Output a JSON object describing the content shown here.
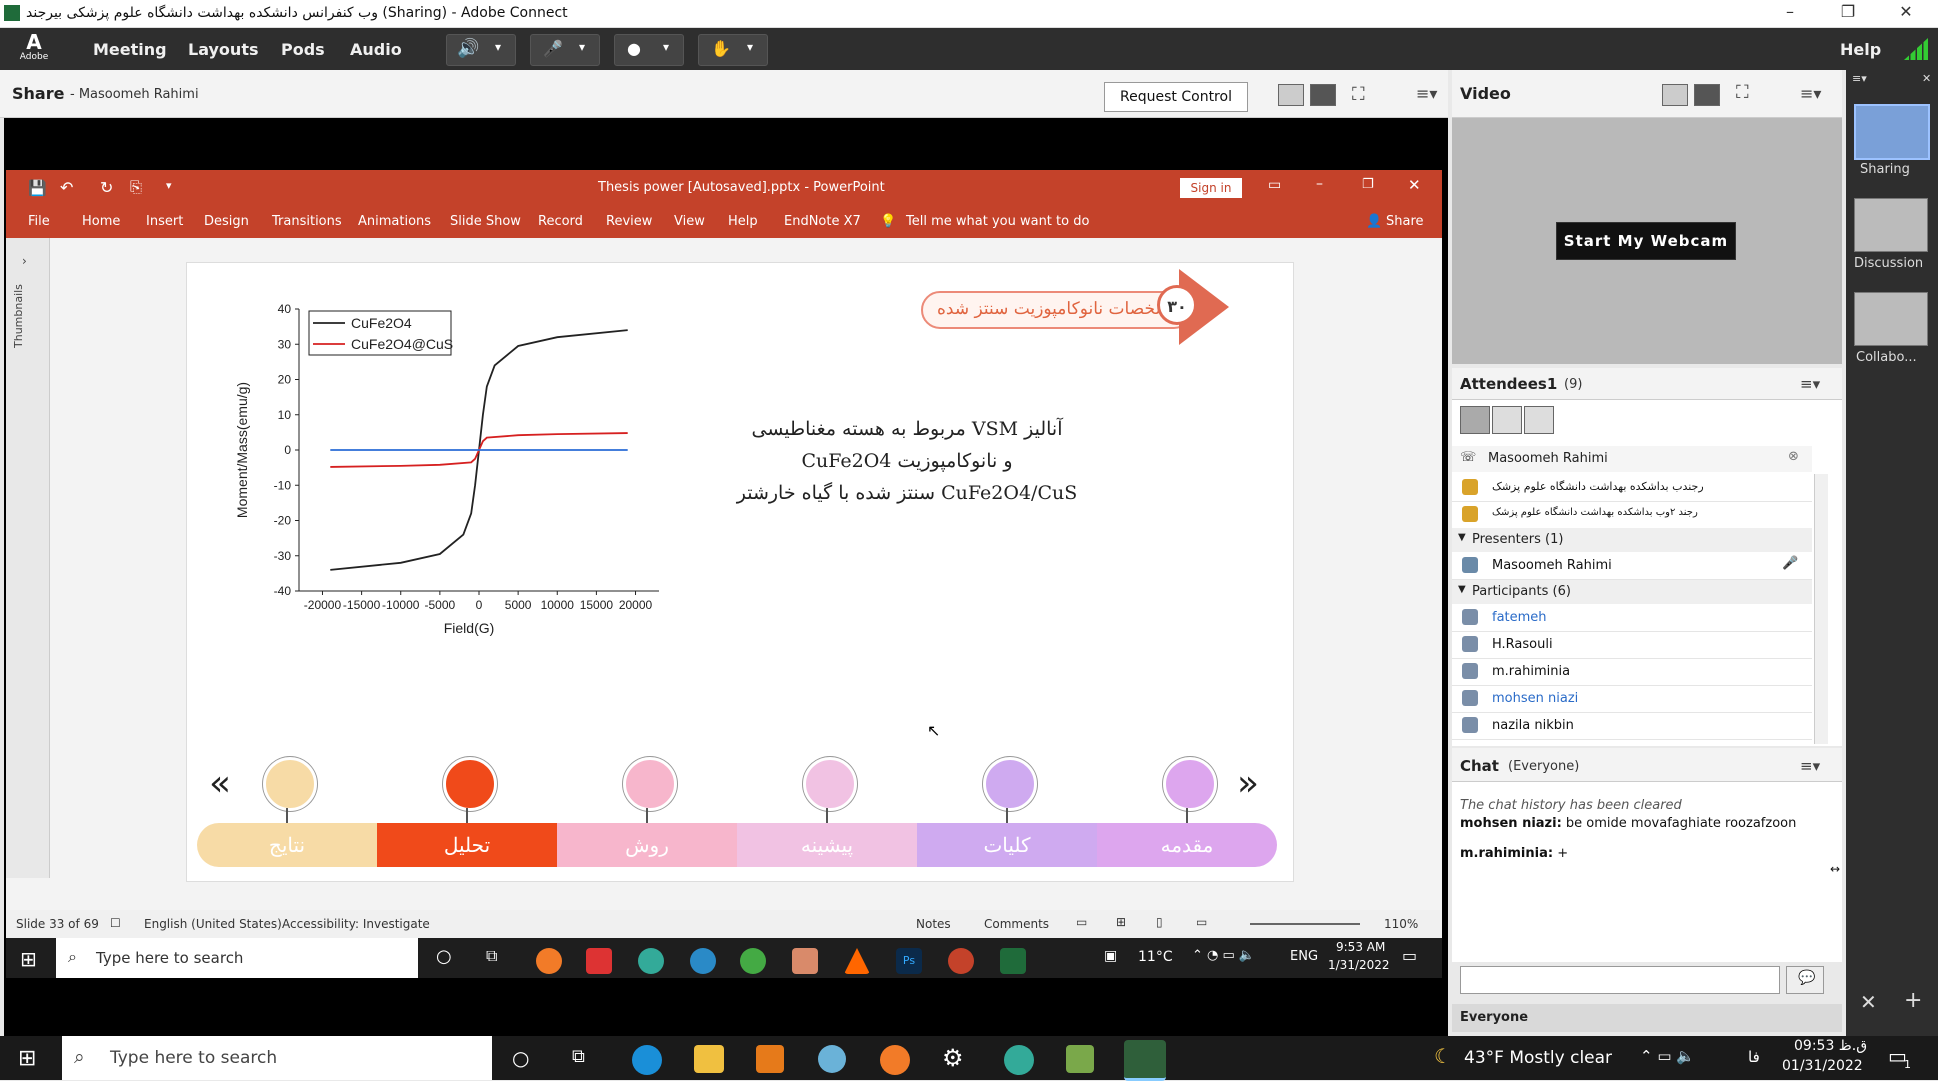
{
  "window": {
    "title": "وب کنفرانس دانشکده بهداشت دانشگاه علوم پزشکی بیرجند (Sharing) - Adobe Connect"
  },
  "menubar": {
    "brand": "Adobe",
    "items": [
      "Meeting",
      "Layouts",
      "Pods",
      "Audio"
    ],
    "help": "Help"
  },
  "share": {
    "title": "Share",
    "presenter": "- Masoomeh Rahimi",
    "request_control": "Request Control"
  },
  "ppt": {
    "doc_title": "Thesis power [Autosaved].pptx  -  PowerPoint",
    "signin": "Sign in",
    "ribbon": [
      "File",
      "Home",
      "Insert",
      "Design",
      "Transitions",
      "Animations",
      "Slide Show",
      "Record",
      "Review",
      "View",
      "Help",
      "EndNote X7"
    ],
    "tell_me": "Tell me what you want to do",
    "share": "Share",
    "thumbnails": "Thumbnails",
    "status": {
      "slide": "Slide 33 of 69",
      "lang": "English (United States)",
      "accessibility": "Accessibility: Investigate",
      "notes": "Notes",
      "comments": "Comments",
      "zoom": "110%"
    }
  },
  "slide": {
    "banner": "مشخصات نانوکامپوزیت سنتز شده",
    "banner_num": "۳۰",
    "text_line1": "آنالیز VSM مربوط به هسته مغناطیسی",
    "text_line2": "و نانوکامپوزیت CuFe2O4",
    "text_line3": "CuFe2O4/CuS سنتز شده با گیاه خارشتر",
    "nav_tabs": [
      "نتایج",
      "تحلیل",
      "روش",
      "پیشینه",
      "کلیات",
      "مقدمه"
    ],
    "nav_colors": [
      "#f7dba6",
      "#f04a1a",
      "#f7b6cc",
      "#f1c2e3",
      "#cfaaf0",
      "#dda6ee"
    ]
  },
  "chart_data": {
    "type": "line",
    "xlabel": "Field(G)",
    "ylabel": "Moment/Mass(emu/g)",
    "xlim": [
      -23000,
      23000
    ],
    "ylim": [
      -40,
      40
    ],
    "xticks": [
      "-20000",
      "-15000",
      "-10000",
      "-5000",
      "0",
      "5000",
      "10000",
      "15000",
      "20000"
    ],
    "yticks": [
      "40",
      "30",
      "20",
      "10",
      "0",
      "-10",
      "-20",
      "-30",
      "-40"
    ],
    "legend_position": "top-left",
    "series": [
      {
        "name": "CuFe2O4",
        "color": "#222222",
        "x": [
          -19000,
          -10000,
          -5000,
          -2000,
          -1000,
          -500,
          0,
          500,
          1000,
          2000,
          5000,
          10000,
          19000
        ],
        "y": [
          -34,
          -32,
          -29.5,
          -24,
          -18,
          -10,
          0,
          10,
          18,
          24,
          29.5,
          32,
          34
        ]
      },
      {
        "name": "CuFe2O4@CuS",
        "color": "#d62020",
        "x": [
          -19000,
          -10000,
          -5000,
          -1000,
          -500,
          0,
          500,
          1000,
          5000,
          10000,
          19000
        ],
        "y": [
          -4.8,
          -4.5,
          -4.2,
          -3.5,
          -2.5,
          0,
          2.5,
          3.5,
          4.2,
          4.5,
          4.8
        ]
      },
      {
        "name": "",
        "color": "#2a6bd6",
        "x": [
          -19000,
          19000
        ],
        "y": [
          0,
          0
        ]
      }
    ]
  },
  "video": {
    "title": "Video",
    "webcam": "Start My Webcam"
  },
  "attendees": {
    "title": "Attendees1",
    "count": "(9)",
    "host": "Masoomeh Rahimi",
    "hosts_rows": [
      "رجندب بداشکده بهداشت  دانشگاه علوم پزشک",
      "رجند ۲وب بداشکده بهداشت  دانشگاه علوم پزشک"
    ],
    "presenters_label": "Presenters (1)",
    "presenters": [
      "Masoomeh Rahimi"
    ],
    "participants_label": "Participants (6)",
    "participants": [
      "fatemeh",
      "H.Rasouli",
      "m.rahiminia",
      "mohsen niazi",
      "nazila nikbin"
    ]
  },
  "chat": {
    "title": "Chat",
    "scope": "(Everyone)",
    "cleared": "The chat history has been cleared",
    "msg1_user": "mohsen niazi:",
    "msg1_text": "be omide movafaghiate roozafzoon",
    "msg2_user": "m.rahiminia:",
    "msg2_text": "+",
    "send_to": "Everyone"
  },
  "layouts": {
    "items": [
      "Sharing",
      "Discussion",
      "Collabo..."
    ]
  },
  "inner_taskbar": {
    "search": "Type here to search",
    "weather": "11°C",
    "lang": "ENG",
    "time": "9:53 AM",
    "date": "1/31/2022"
  },
  "os_taskbar": {
    "search": "Type here to search",
    "weather": "43°F  Mostly clear",
    "lang": "فا",
    "time": "09:53 ق.ظ",
    "date": "01/31/2022",
    "notif_count": "1"
  }
}
